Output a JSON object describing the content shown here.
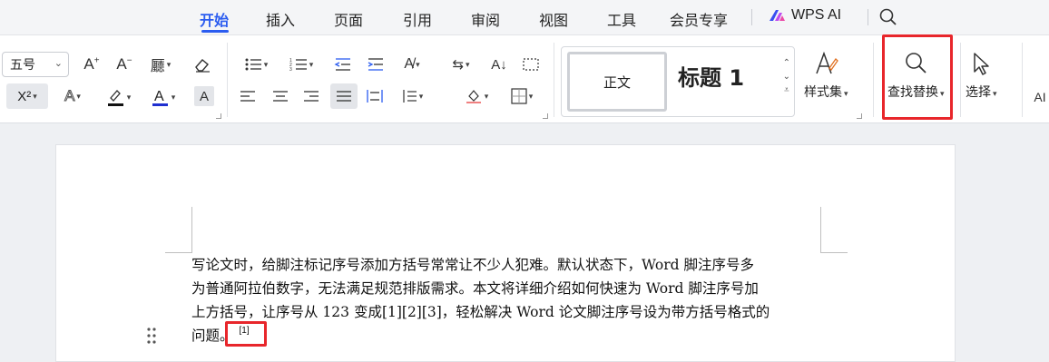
{
  "menu": {
    "tabs": [
      {
        "label": "开始",
        "active": true
      },
      {
        "label": "插入"
      },
      {
        "label": "页面"
      },
      {
        "label": "引用"
      },
      {
        "label": "审阅"
      },
      {
        "label": "视图"
      },
      {
        "label": "工具"
      },
      {
        "label": "会员专享"
      }
    ],
    "wps_ai": "WPS AI"
  },
  "ribbon": {
    "font_size": "五号",
    "superscript": "X²",
    "styles": {
      "normal": "正文",
      "heading": "标题 1",
      "style_set": "样式集"
    },
    "find_replace": "查找替换",
    "select": "选择",
    "ai": "AI"
  },
  "document": {
    "lines": [
      "写论文时，给脚注标记序号添加方括号常常让不少人犯难。默认状态下，Word 脚注序号多",
      "为普通阿拉伯数字，无法满足规范排版需求。本文将详细介绍如何快速为 Word 脚注序号加",
      "上方括号，让序号从 123 变成[1][2][3]，轻松解决 Word 论文脚注序号设为带方括号格式的",
      "问题。"
    ],
    "footnote_ref": "[1]"
  },
  "colors": {
    "accent": "#2b5cf0",
    "highlight": "#e8262b",
    "font_color": "#1f2fd0"
  }
}
